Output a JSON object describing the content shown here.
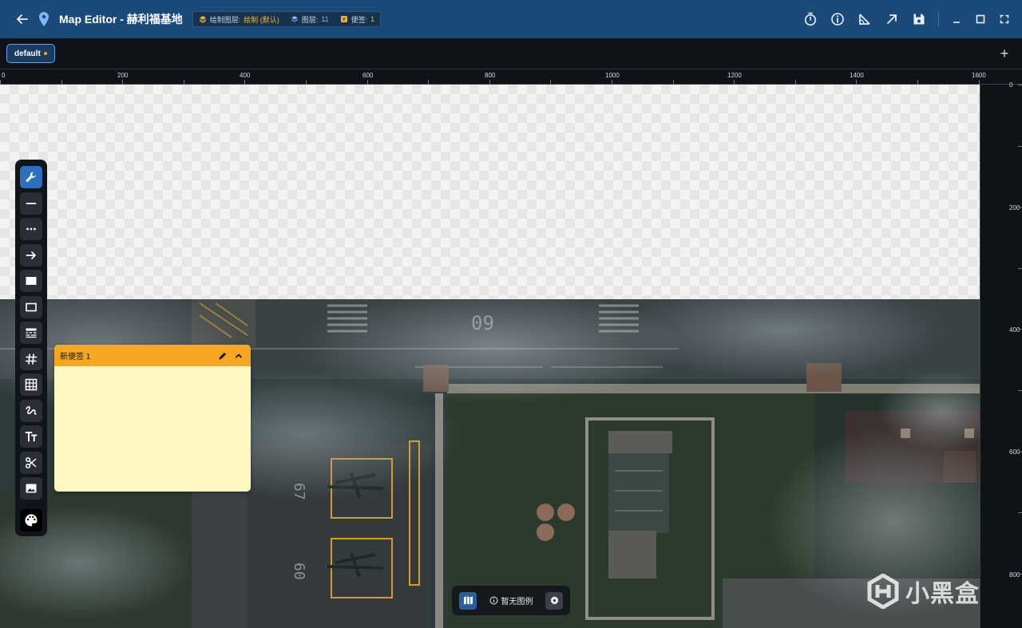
{
  "window": {
    "title": "Map Editor - 赫利福基地",
    "icons": [
      "back-arrow-icon",
      "map-pin-icon"
    ]
  },
  "status": {
    "draw_layer_label": "绘制图层:",
    "draw_layer_value": "绘制 (默认)",
    "layers_label": "图层:",
    "layers_count": "11",
    "notes_label": "便签:",
    "notes_count": "1"
  },
  "toolbar_right": {
    "icons": [
      "timer-icon",
      "info-icon",
      "measure-angle-icon",
      "arrow-up-right-icon",
      "save-icon",
      "minimize-icon",
      "maximize-icon",
      "fullscreen-icon"
    ]
  },
  "tabs": {
    "items": [
      {
        "label": "default",
        "unsaved": true
      }
    ],
    "add_label": "+"
  },
  "ruler": {
    "top_labels": [
      "0",
      "200",
      "400",
      "600",
      "800",
      "1000",
      "1200",
      "1400",
      "1600"
    ],
    "right_labels": [
      "0",
      "200",
      "400",
      "600",
      "800"
    ]
  },
  "tools": {
    "items": [
      {
        "name": "wrench",
        "active": true
      },
      {
        "name": "line",
        "active": false
      },
      {
        "name": "dotted-line",
        "active": false
      },
      {
        "name": "arrow",
        "active": false
      },
      {
        "name": "filled-rect",
        "active": false
      },
      {
        "name": "outline-rect",
        "active": false
      },
      {
        "name": "pattern-fill",
        "active": false
      },
      {
        "name": "hash-grid",
        "active": false
      },
      {
        "name": "table-grid",
        "active": false
      },
      {
        "name": "freehand",
        "active": false
      },
      {
        "name": "text",
        "active": false
      },
      {
        "name": "scissors",
        "active": false
      },
      {
        "name": "image",
        "active": false
      },
      {
        "name": "palette",
        "active": false
      }
    ]
  },
  "note": {
    "title": "新便签 1",
    "body": "",
    "header_color": "#f5a623",
    "body_color": "#fef7c2"
  },
  "legend": {
    "empty_text": "暂无图例"
  },
  "watermark": {
    "text": "小黑盒"
  },
  "colors": {
    "titlebar": "#1c4a78",
    "accent": "#2c6fbf",
    "warning": "#f5a623"
  }
}
